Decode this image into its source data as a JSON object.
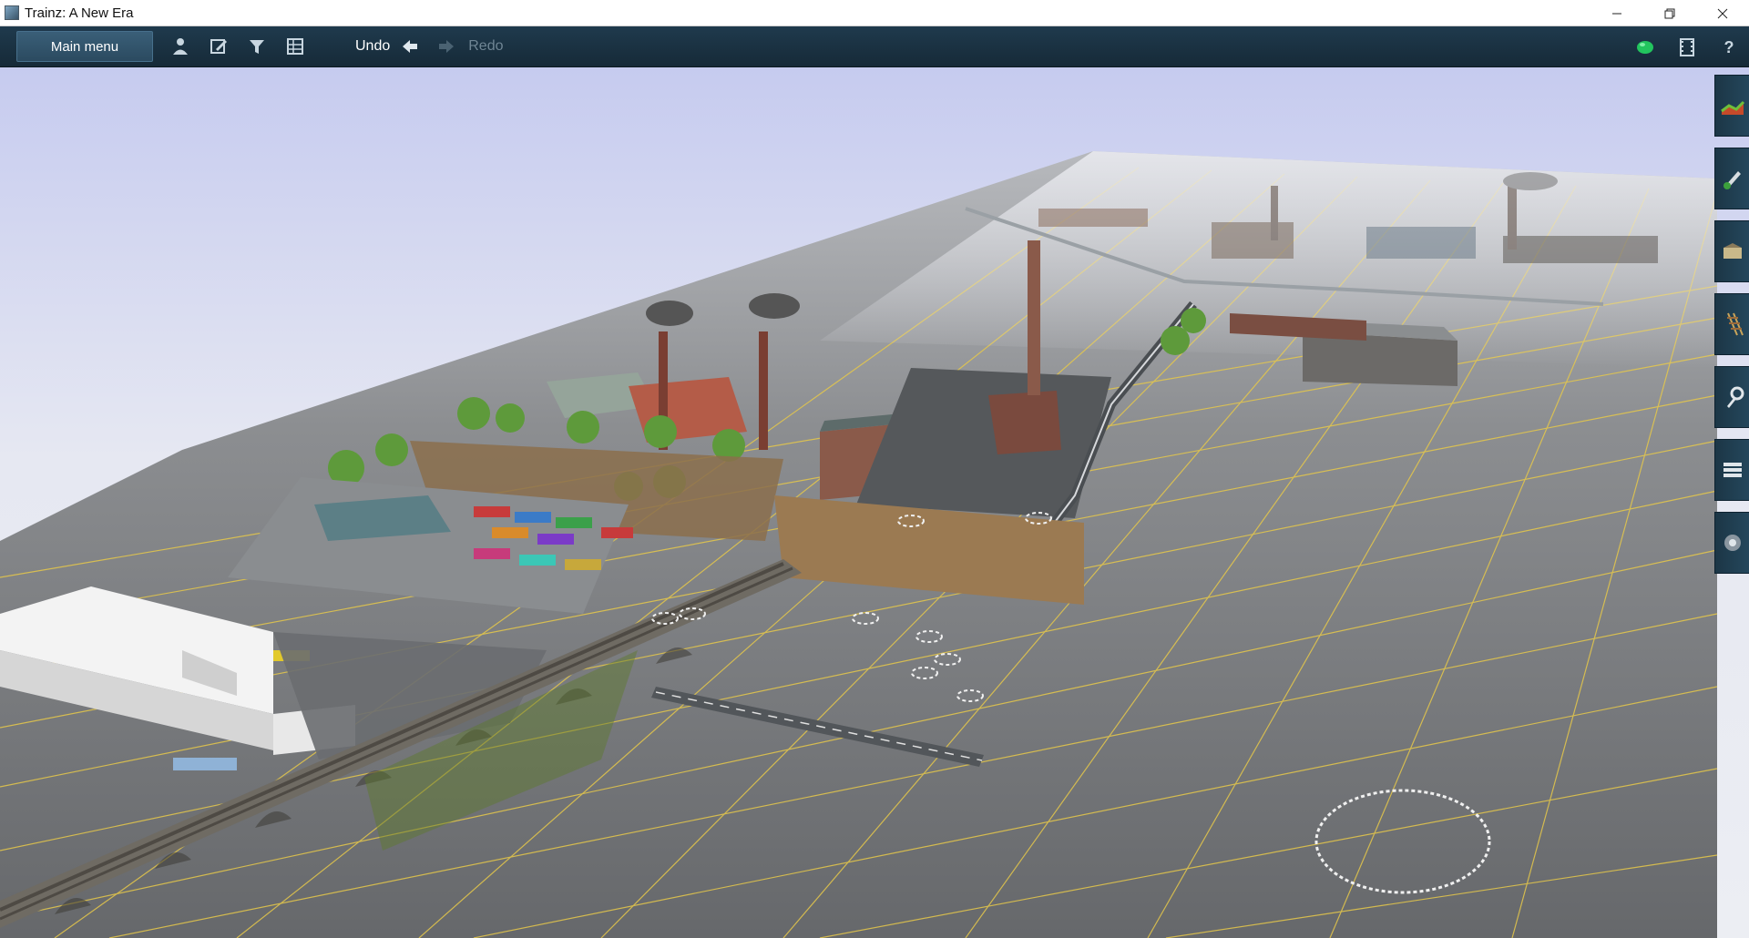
{
  "window": {
    "title": "Trainz: A New Era",
    "controls": [
      "minimize-icon",
      "restore-icon",
      "close-icon"
    ]
  },
  "toolbar": {
    "main_menu_label": "Main menu",
    "left_icons": [
      "driver-icon",
      "edit-icon",
      "filter-icon",
      "grid-icon"
    ],
    "undo_label": "Undo",
    "redo_label": "Redo",
    "right_icons": [
      "status-light-icon",
      "film-icon",
      "help-icon"
    ],
    "status_color": "#22c55e"
  },
  "side_palette": {
    "tools": [
      "terrain-tool-icon",
      "paint-tool-icon",
      "objects-tool-icon",
      "track-tool-icon",
      "wrench-tool-icon",
      "layers-tool-icon",
      "camera-tool-icon"
    ]
  },
  "viewport": {
    "description_colors": {
      "grid": "#e6c84a",
      "ground": "#6f7174",
      "sky_top": "#c9cdf0",
      "sky_bottom": "#e8eaf2"
    }
  }
}
